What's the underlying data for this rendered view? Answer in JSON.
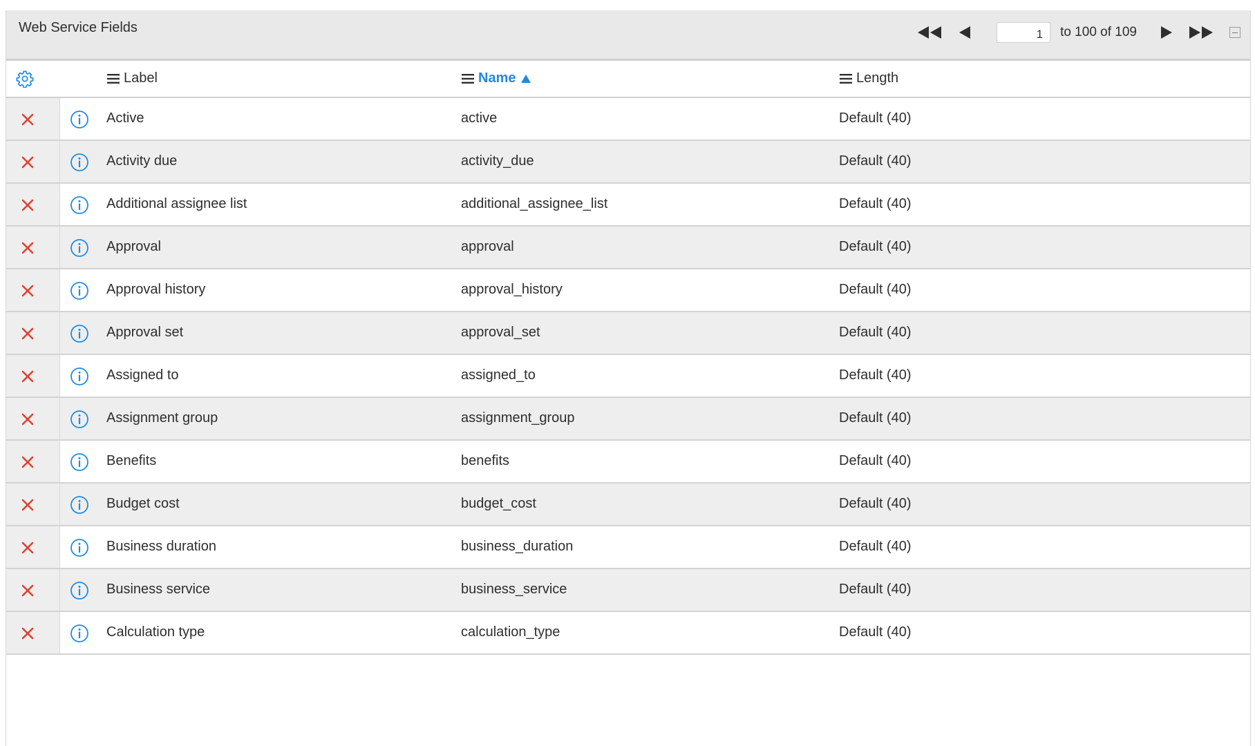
{
  "panel": {
    "title": "Web Service Fields",
    "pager": {
      "page_value": "1",
      "range_text": "to 100 of 109"
    }
  },
  "columns": {
    "label": "Label",
    "name": "Name",
    "length": "Length",
    "sorted_column": "name",
    "sort_direction": "ascending"
  },
  "rows": [
    {
      "label": "Active",
      "name": "active",
      "length": "Default (40)"
    },
    {
      "label": "Activity due",
      "name": "activity_due",
      "length": "Default (40)"
    },
    {
      "label": "Additional assignee list",
      "name": "additional_assignee_list",
      "length": "Default (40)"
    },
    {
      "label": "Approval",
      "name": "approval",
      "length": "Default (40)"
    },
    {
      "label": "Approval history",
      "name": "approval_history",
      "length": "Default (40)"
    },
    {
      "label": "Approval set",
      "name": "approval_set",
      "length": "Default (40)"
    },
    {
      "label": "Assigned to",
      "name": "assigned_to",
      "length": "Default (40)"
    },
    {
      "label": "Assignment group",
      "name": "assignment_group",
      "length": "Default (40)"
    },
    {
      "label": "Benefits",
      "name": "benefits",
      "length": "Default (40)"
    },
    {
      "label": "Budget cost",
      "name": "budget_cost",
      "length": "Default (40)"
    },
    {
      "label": "Business duration",
      "name": "business_duration",
      "length": "Default (40)"
    },
    {
      "label": "Business service",
      "name": "business_service",
      "length": "Default (40)"
    },
    {
      "label": "Calculation type",
      "name": "calculation_type",
      "length": "Default (40)"
    }
  ],
  "icons": {
    "first": "first-page-icon",
    "prev": "previous-page-icon",
    "next": "next-page-icon",
    "last": "last-page-icon",
    "collapse": "collapse-icon",
    "settings": "gear-icon",
    "column_menu": "hamburger-menu-icon",
    "sort": "sort-ascending-icon",
    "delete": "delete-x-icon",
    "info": "info-icon"
  },
  "colors": {
    "accent": "#1f8ae2",
    "delete": "#e0412e",
    "title_bar": "#e9e9e9",
    "stripe": "#eeeeee"
  }
}
